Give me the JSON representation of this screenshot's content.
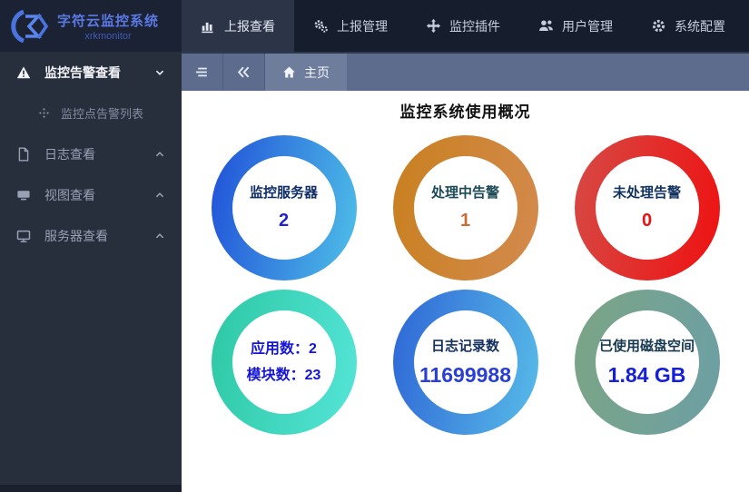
{
  "navbar": {
    "logo_title": "字符云监控系统",
    "logo_subtitle": "xrkmonitor",
    "items": [
      {
        "label": "上报查看",
        "icon": "bar-chart-icon",
        "active": true
      },
      {
        "label": "上报管理",
        "icon": "gears-icon",
        "active": false
      },
      {
        "label": "监控插件",
        "icon": "move-icon",
        "active": false
      },
      {
        "label": "用户管理",
        "icon": "users-icon",
        "active": false
      },
      {
        "label": "系统配置",
        "icon": "gear-icon",
        "active": false
      }
    ]
  },
  "sidebar": {
    "items": [
      {
        "label": "监控告警查看",
        "icon": "warning-icon",
        "chevron": "down",
        "active": true,
        "sub": false
      },
      {
        "label": "监控点告警列表",
        "icon": "compass-icon",
        "chevron": "",
        "active": false,
        "sub": true
      },
      {
        "label": "日志查看",
        "icon": "file-icon",
        "chevron": "up",
        "active": false,
        "sub": false
      },
      {
        "label": "视图查看",
        "icon": "view-icon",
        "chevron": "up",
        "active": false,
        "sub": false
      },
      {
        "label": "服务器查看",
        "icon": "server-icon",
        "chevron": "up",
        "active": false,
        "sub": false
      }
    ]
  },
  "breadcrumb": {
    "menu_icon": "menu-fold-icon",
    "collapse_icon": "double-chevron-left-icon",
    "home_tab": "主页"
  },
  "main": {
    "title": "监控系统使用概况",
    "rings": [
      {
        "name": "monitored-servers",
        "gradient": [
          "#2050d8",
          "#4fc0e8"
        ],
        "lines": [
          {
            "text": "监控服务器",
            "kind": "label",
            "color": "#0f2d66"
          },
          {
            "text": "2",
            "kind": "value",
            "color": "#1e23cf"
          }
        ]
      },
      {
        "name": "alarms-in-progress",
        "gradient": [
          "#c9801f",
          "#d38a4e"
        ],
        "lines": [
          {
            "text": "处理中告警",
            "kind": "label",
            "color": "#1c4a56"
          },
          {
            "text": "1",
            "kind": "value",
            "color": "#cb6b35"
          }
        ]
      },
      {
        "name": "unhandled-alarms",
        "gradient": [
          "#d64a45",
          "#ee1111"
        ],
        "lines": [
          {
            "text": "未处理告警",
            "kind": "label",
            "color": "#12325e"
          },
          {
            "text": "0",
            "kind": "value",
            "color": "#ea1111"
          }
        ]
      },
      {
        "name": "apps-and-modules",
        "gradient": [
          "#2dc8a4",
          "#55e5d8"
        ],
        "lines": [
          {
            "text": "应用数：2",
            "kind": "value-sm",
            "color": "#1616d8"
          },
          {
            "text": "模块数：23",
            "kind": "value-sm",
            "color": "#1616d8"
          }
        ]
      },
      {
        "name": "log-records",
        "gradient": [
          "#2e66d6",
          "#58bce8"
        ],
        "lines": [
          {
            "text": "日志记录数",
            "kind": "label",
            "color": "#122f5e"
          },
          {
            "text": "11699988",
            "kind": "value-lg",
            "color": "#2a3fd6"
          }
        ]
      },
      {
        "name": "disk-space-used",
        "gradient": [
          "#7ba585",
          "#6d9fa5"
        ],
        "lines": [
          {
            "text": "已使用磁盘空间",
            "kind": "label",
            "color": "#173a52"
          },
          {
            "text": "1.84 GB",
            "kind": "value-lg",
            "color": "#1520d8"
          }
        ]
      }
    ]
  },
  "colors": {
    "navbar_bg": "#161d2c",
    "active_nav_bg": "#2b3547",
    "sidebar_bg": "#272e3c",
    "breadcrumb_bg": "#5d6b8d",
    "home_tab_bg": "#6f7d9d",
    "accent_blue": "#5b79e4"
  }
}
